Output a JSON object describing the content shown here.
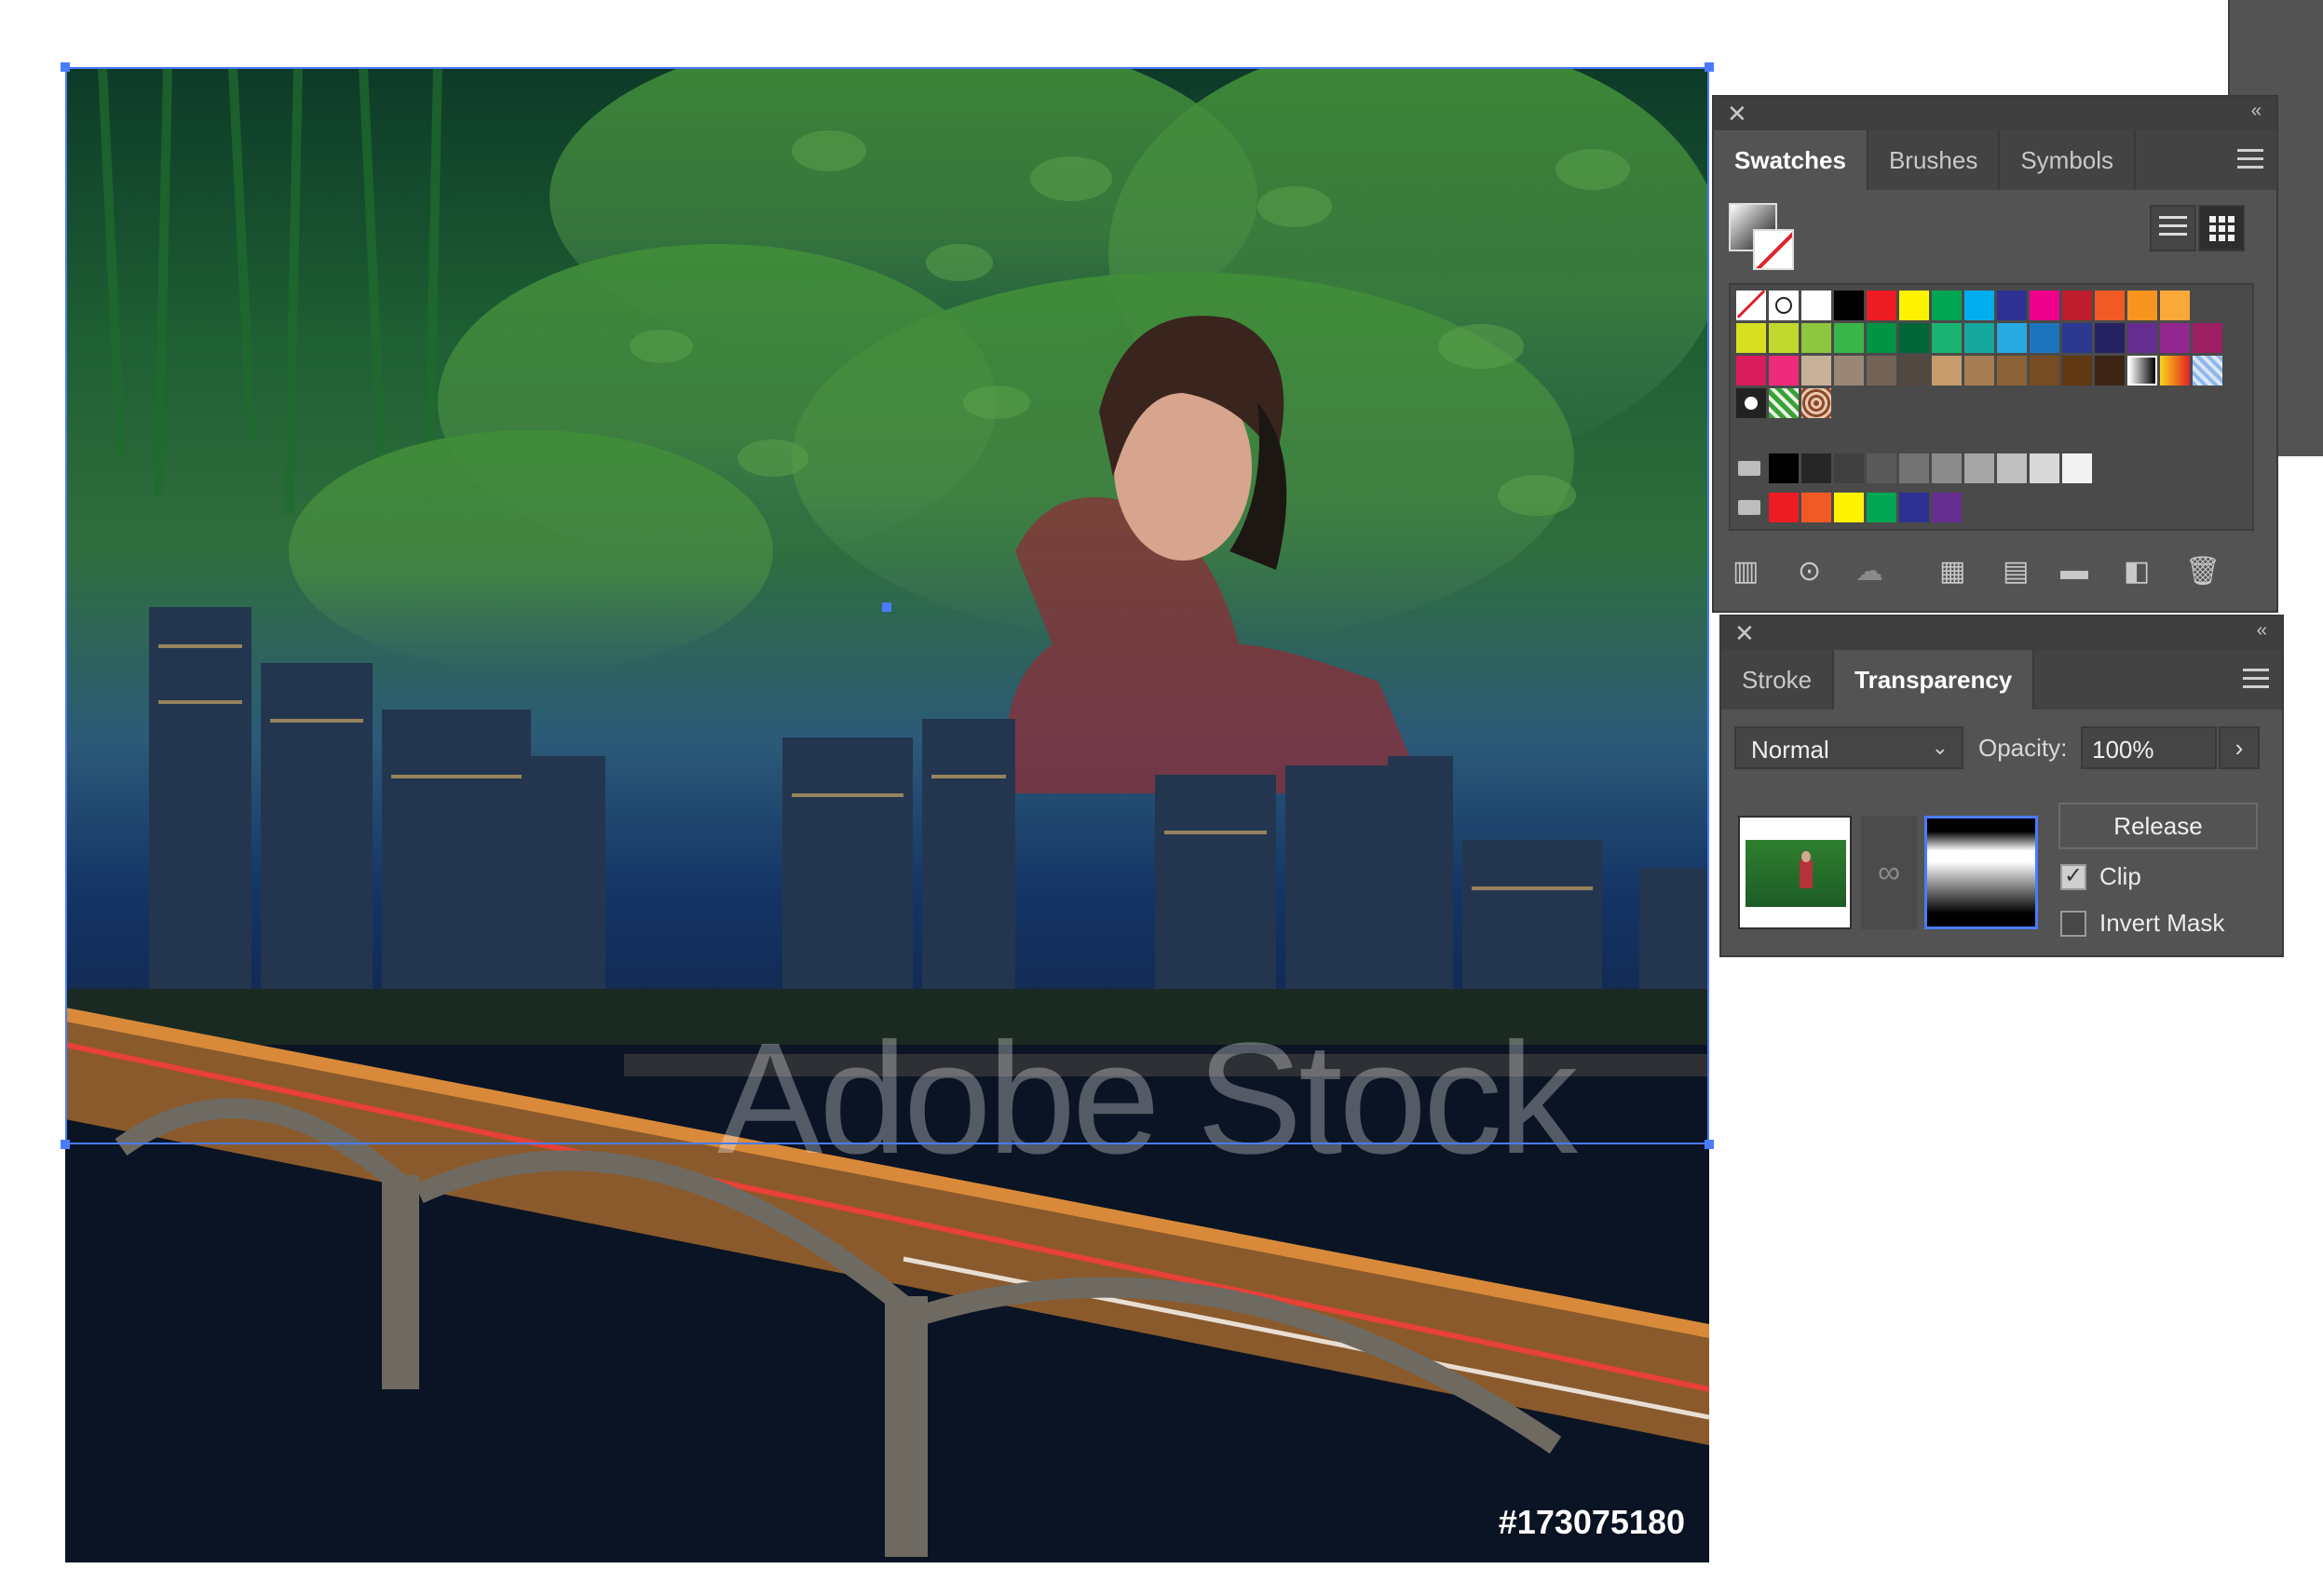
{
  "canvas": {
    "watermark": "Adobe Stock",
    "stock_id": "#173075180"
  },
  "swatches_panel": {
    "tabs": [
      {
        "label": "Swatches",
        "active": true
      },
      {
        "label": "Brushes",
        "active": false
      },
      {
        "label": "Symbols",
        "active": false
      }
    ],
    "rows": [
      [
        "none",
        "registration",
        "#ffffff",
        "#000000",
        "#ed1c24",
        "#fff200",
        "#00a651",
        "#00aeef",
        "#2e3192",
        "#ec008c",
        "#be1e2d",
        "#f15a24",
        "#f7941d",
        "#f9a83a"
      ],
      [
        "#d7df23",
        "#c1d82f",
        "#8dc63f",
        "#39b54a",
        "#009444",
        "#006838",
        "#1bb373",
        "#16a89e",
        "#27aae1",
        "#1c75bc",
        "#2b3990",
        "#262262",
        "#662d91",
        "#92278f",
        "#9e1f63"
      ],
      [
        "#da1c5c",
        "#ee2a7b",
        "#c7b299",
        "#998675",
        "#736357",
        "#534741",
        "#c69c6d",
        "#a67c52",
        "#8c6239",
        "#754c24",
        "#603913",
        "#3c2415",
        "gradient1",
        "gradient2",
        "gradient3"
      ],
      [
        "pattern1",
        "pattern2",
        "pattern3"
      ]
    ],
    "gray_group": [
      "#000000",
      "#262626",
      "#404040",
      "#595959",
      "#737373",
      "#8c8c8c",
      "#a6a6a6",
      "#bfbfbf",
      "#d9d9d9",
      "#f2f2f2"
    ],
    "bright_group": [
      "#ed1c24",
      "#f15a24",
      "#fff200",
      "#00a651",
      "#2e3192",
      "#662d91"
    ]
  },
  "transparency_panel": {
    "tabs": [
      {
        "label": "Stroke",
        "active": false
      },
      {
        "label": "Transparency",
        "active": true
      }
    ],
    "blend_mode": "Normal",
    "opacity_label": "Opacity:",
    "opacity_value": "100%",
    "release_label": "Release",
    "clip_label": "Clip",
    "clip_checked": true,
    "invert_mask_label": "Invert Mask",
    "invert_mask_checked": false
  },
  "icons": {
    "close": "✕",
    "collapse": "‹‹",
    "dropdown_chevron": "⌄",
    "arrow_right": "›"
  }
}
